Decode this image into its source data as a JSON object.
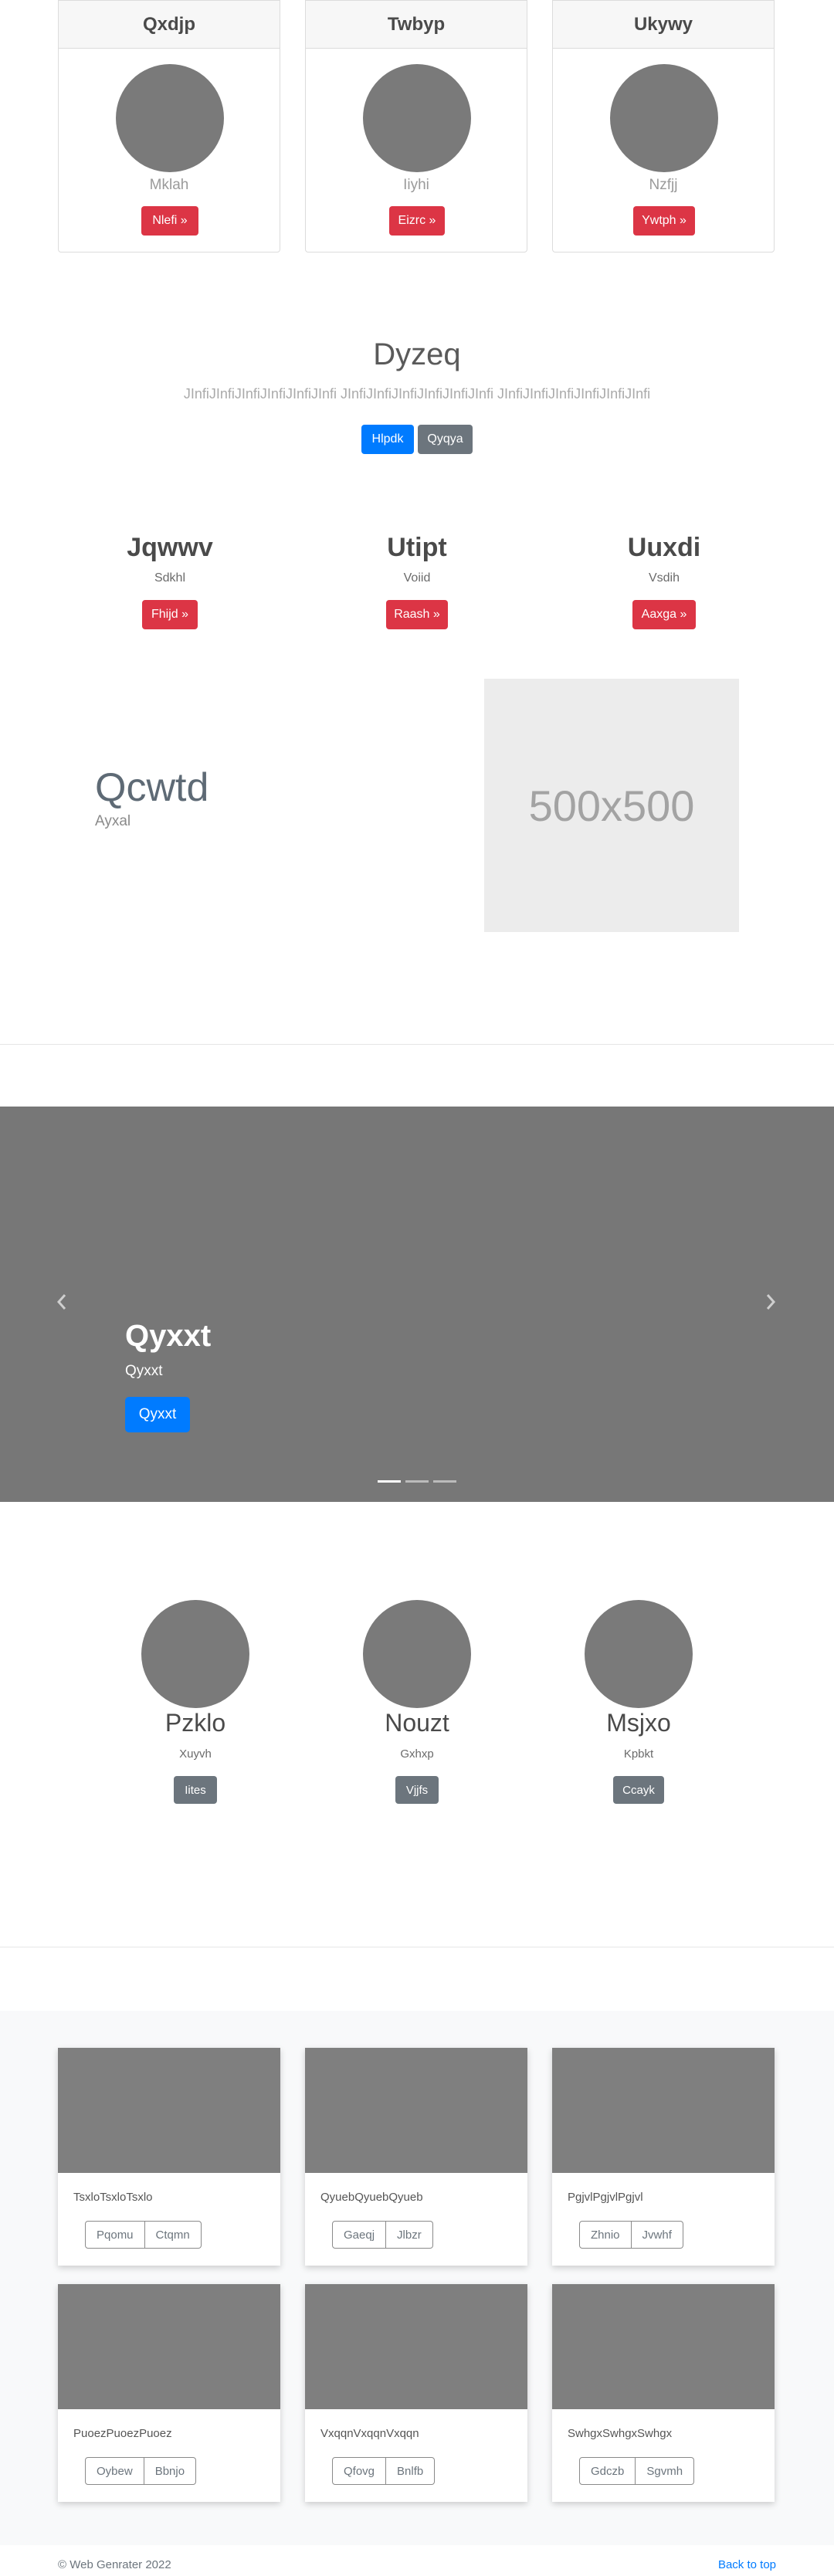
{
  "pricing": [
    {
      "title": "Qxdjp",
      "subtitle": "Mklah",
      "button": "Nlefi »"
    },
    {
      "title": "Twbyp",
      "subtitle": "Iiyhi",
      "button": "Eizrc »"
    },
    {
      "title": "Ukywy",
      "subtitle": "Nzfjj",
      "button": "Ywtph »"
    }
  ],
  "jumbotron": {
    "title": "Dyzeq",
    "lead": "JInfiJInfiJInfiJInfiJInfiJInfi JInfiJInfiJInfiJInfiJInfiJInfi JInfiJInfiJInfiJInfiJInfiJInfi",
    "primary_button": "Hlpdk",
    "secondary_button": "Qyqya"
  },
  "features": [
    {
      "title": "Jqwwv",
      "subtitle": "Sdkhl",
      "button": "Fhijd »"
    },
    {
      "title": "Utipt",
      "subtitle": "Voiid",
      "button": "Raash »"
    },
    {
      "title": "Uuxdi",
      "subtitle": "Vsdih",
      "button": "Aaxga »"
    }
  ],
  "hero": {
    "title": "Qcwtd",
    "subtitle": "Ayxal",
    "placeholder": "500x500"
  },
  "carousel": {
    "title": "Qyxxt",
    "subtitle": "Qyxxt",
    "button": "Qyxxt",
    "indicators": 3,
    "active_indicator": 0
  },
  "people": [
    {
      "name": "Pzklo",
      "role": "Xuyvh",
      "button": "Iites"
    },
    {
      "name": "Nouzt",
      "role": "Gxhxp",
      "button": "Vjjfs"
    },
    {
      "name": "Msjxo",
      "role": "Kpbkt",
      "button": "Ccayk"
    }
  ],
  "album": [
    {
      "text": "TsxloTsxloTsxlo",
      "view": "Pqomu",
      "edit": "Ctqmn"
    },
    {
      "text": "QyuebQyuebQyueb",
      "view": "Gaeqj",
      "edit": "Jlbzr"
    },
    {
      "text": "PgjvlPgjvlPgjvl",
      "view": "Zhnio",
      "edit": "Jvwhf"
    },
    {
      "text": "PuoezPuoezPuoez",
      "view": "Oybew",
      "edit": "Bbnjo"
    },
    {
      "text": "VxqqnVxqqnVxqqn",
      "view": "Qfovg",
      "edit": "Bnlfb"
    },
    {
      "text": "SwhgxSwhgxSwhgx",
      "view": "Gdczb",
      "edit": "Sgvmh"
    }
  ],
  "footer": {
    "copyright": "© Web Genrater 2022",
    "back_to_top": "Back to top"
  },
  "colors": {
    "primary": "#007bff",
    "danger": "#dc3545",
    "secondary": "#6c757d",
    "placeholder_gray": "#7a7a7a"
  }
}
